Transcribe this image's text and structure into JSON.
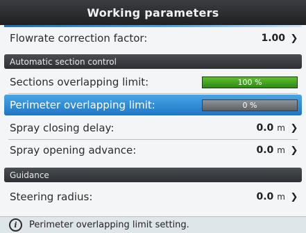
{
  "window": {
    "title": "Working parameters"
  },
  "rows": {
    "flowrate": {
      "label": "Flowrate correction factor:",
      "value": "1.00",
      "icon": "chevron-right-icon"
    },
    "sections_overlap": {
      "label": "Sections overlapping limit:",
      "value": "100 %",
      "level_percent": 100,
      "color": "#3fa020"
    },
    "perimeter_overlap": {
      "label": "Perimeter overlapping limit:",
      "value": "0 %",
      "level_percent": 0
    },
    "spray_closing": {
      "label": "Spray closing delay:",
      "value": "0.0",
      "unit": "m",
      "icon": "chevron-right-icon"
    },
    "spray_opening": {
      "label": "Spray opening advance:",
      "value": "0.0",
      "unit": "m",
      "icon": "chevron-right-icon"
    },
    "steering_radius": {
      "label": "Steering radius:",
      "value": "0.0",
      "unit": "m",
      "icon": "chevron-right-icon"
    }
  },
  "sections": {
    "auto_section_control": "Automatic section control",
    "guidance": "Guidance"
  },
  "status": {
    "icon": "info-icon",
    "text": "Perimeter overlapping limit setting."
  },
  "colors": {
    "selection": "#2f8ad4",
    "header": "#2d2f33",
    "accent": "#1d6fb7"
  }
}
